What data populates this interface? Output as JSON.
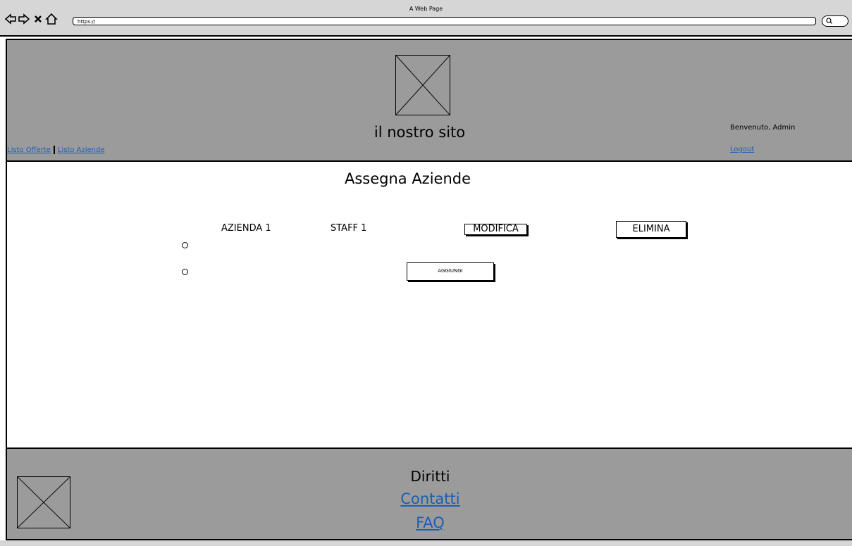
{
  "browser": {
    "window_title": "A Web Page",
    "url": "https://",
    "nav_icons": [
      "back-icon",
      "forward-icon",
      "close-icon",
      "home-icon"
    ],
    "search_icon": "search-icon"
  },
  "header": {
    "site_name": "il nostro sito",
    "welcome": "Benvenuto, Admin",
    "logout": "Logout",
    "nav": [
      "Listo Offerte",
      "Listo Aziende"
    ],
    "logo": "image-placeholder-icon",
    "background": "#9b9b9b"
  },
  "main": {
    "title": "Assegna Aziende",
    "rows": [
      {
        "azienda": "AZIENDA 1",
        "staff": "STAFF 1",
        "modifica": "MODIFICA",
        "elimina": "ELIMINA"
      }
    ],
    "add_button": "AGGIUNGI"
  },
  "footer": {
    "diritti": "Diritti",
    "contatti": "Contatti",
    "faq": "FAQ",
    "logo": "image-placeholder-icon"
  },
  "colors": {
    "link": "#1a5fb4",
    "panel": "#9b9b9b",
    "chrome": "#d6d6d6"
  }
}
